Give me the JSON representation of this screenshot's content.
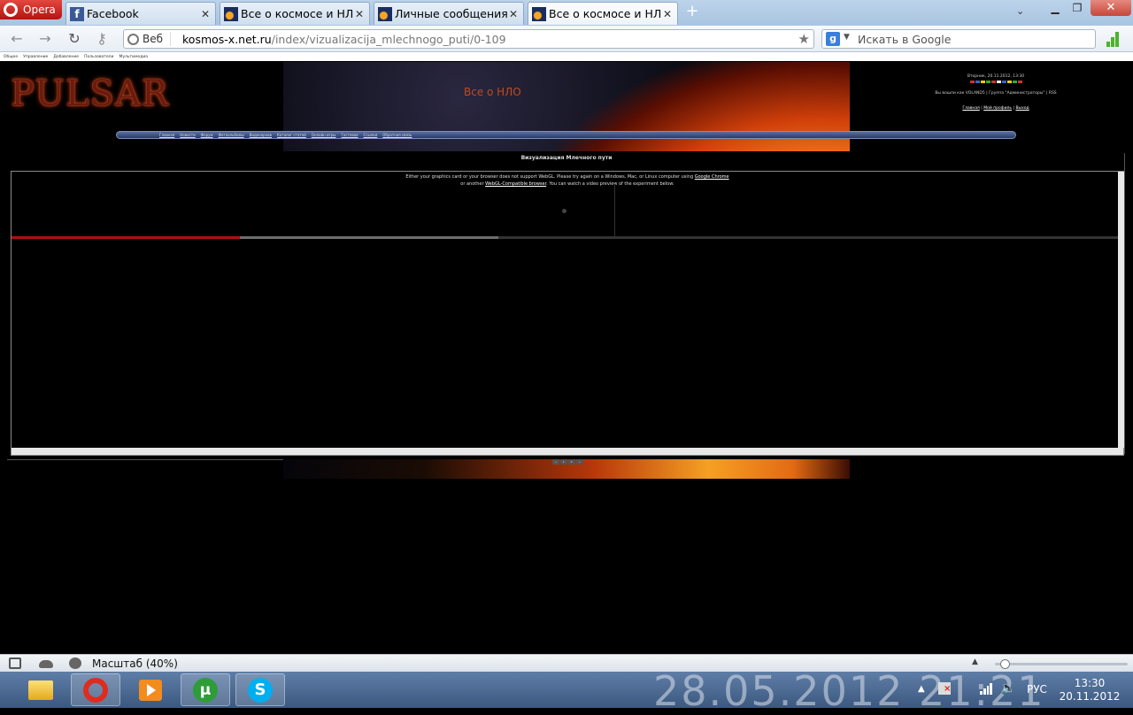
{
  "browser": {
    "menu_label": "Opera",
    "tabs": [
      {
        "title": "Facebook",
        "favicon": "facebook-icon",
        "active": false
      },
      {
        "title": "Все о космосе и НЛО ...",
        "favicon": "space-icon",
        "active": false
      },
      {
        "title": "Личные сообщения",
        "favicon": "space-icon",
        "active": false
      },
      {
        "title": "Все о космосе и НЛО ...",
        "favicon": "space-icon",
        "active": true
      }
    ],
    "address": {
      "badge": "Веб",
      "host": "kosmos-x.net.ru",
      "path": "/index/vizualizacija_mlechnogo_puti/0-109"
    },
    "search": {
      "engine": "google",
      "placeholder": "Искать в Google"
    },
    "bookmarks": [
      "Общее",
      "Управление",
      "Добавление",
      "Пользователи",
      "Мультимедиа"
    ]
  },
  "site": {
    "logo": "PULSAR",
    "slogan": "Все о НЛО",
    "top_right": {
      "date_line": "Вторник, 20.11.2012, 13:30",
      "greeting_line": "Вы вошли как VOLAND5 | Группа \"Администраторы\" | RSS",
      "links": [
        "Главная",
        "Мой профиль",
        "Выход"
      ]
    },
    "menu": [
      "Главная",
      "Новости",
      "Форум",
      "Фотоальбомы",
      "Видеоархив",
      "Каталог статей",
      "Онлайн игры",
      "Гостевая",
      "Ссылки",
      "Обратная связь"
    ],
    "content_title": "Визуализация Млечного пути",
    "webgl_message": {
      "line1_prefix": "Either your graphics card or your browser does not support WebGL. Please try again on a Windows, Mac, or Linux computer using",
      "line1_link": "Google Chrome",
      "line2_prefix": "or another",
      "line2_link": "WebGL-Compatible browser",
      "line2_suffix": ". You can watch a video preview of the experiment below:"
    },
    "video": {
      "played_fraction": 0.206,
      "buffered_fraction": 0.44
    },
    "pager": [
      "«",
      "1",
      "2",
      "»"
    ]
  },
  "statusbar": {
    "zoom_label": "Масштаб (40%)",
    "zoom_fraction": 0.04
  },
  "taskbar": {
    "apps": [
      "file-explorer",
      "opera",
      "media-player",
      "utorrent",
      "skype"
    ],
    "watermark": "28.05.2012 21:21",
    "lang": "РУС",
    "time": "13:30",
    "date": "20.11.2012"
  },
  "colors": {
    "accent_red": "#b40d0d",
    "menu_blue": "#263a6b",
    "taskbar": "#3b587f"
  }
}
